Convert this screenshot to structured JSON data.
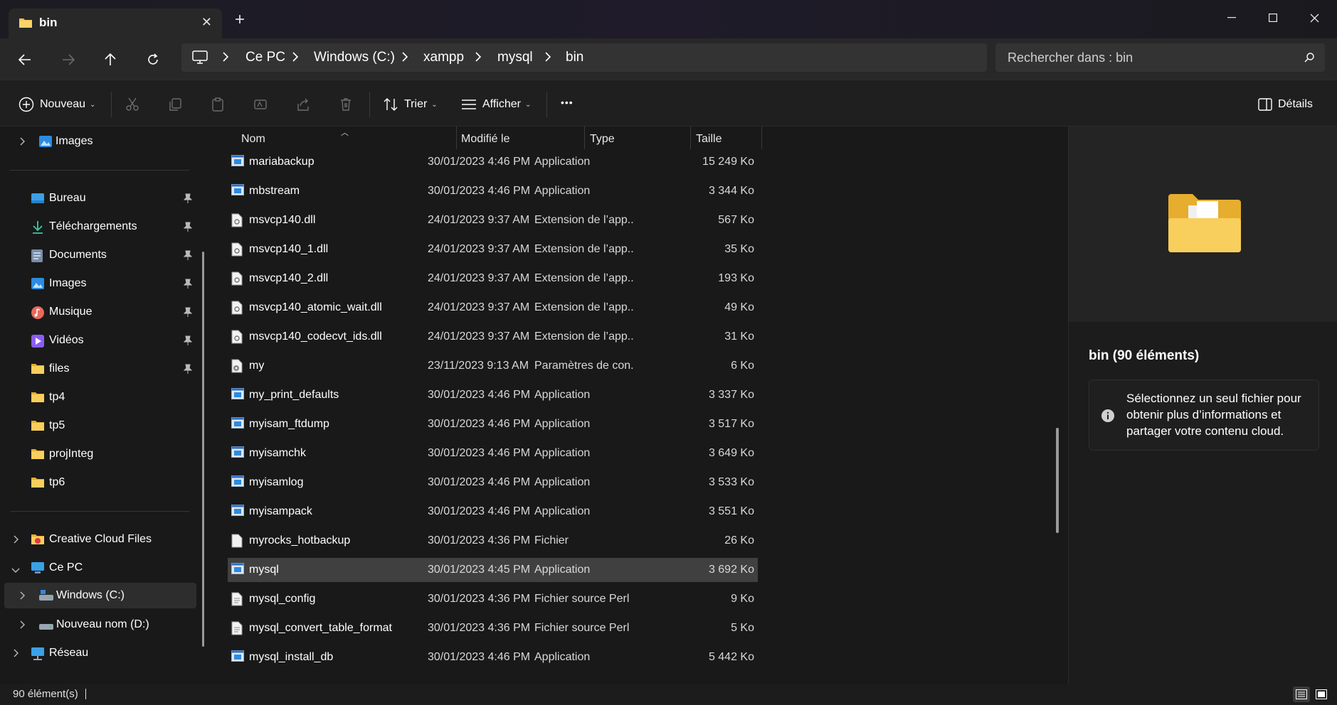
{
  "window": {
    "tab_title": "bin",
    "close_tab": "✕",
    "new_tab": "+"
  },
  "breadcrumb": [
    "Ce PC",
    "Windows (C:)",
    "xampp",
    "mysql",
    "bin"
  ],
  "search": {
    "placeholder": "Rechercher dans : bin"
  },
  "toolbar": {
    "new_label": "Nouveau",
    "sort_label": "Trier",
    "view_label": "Afficher",
    "more_label": "•••",
    "details_label": "Détails"
  },
  "sidebar": {
    "top": {
      "label": "Images"
    },
    "quick_access": [
      {
        "label": "Bureau",
        "icon": "desktop-icon"
      },
      {
        "label": "Téléchargements",
        "icon": "download-icon"
      },
      {
        "label": "Documents",
        "icon": "documents-icon"
      },
      {
        "label": "Images",
        "icon": "pictures-icon"
      },
      {
        "label": "Musique",
        "icon": "music-icon"
      },
      {
        "label": "Vidéos",
        "icon": "videos-icon"
      },
      {
        "label": "files",
        "icon": "folder-icon"
      },
      {
        "label": "tp4",
        "icon": "folder-icon"
      },
      {
        "label": "tp5",
        "icon": "folder-icon"
      },
      {
        "label": "projInteg",
        "icon": "folder-icon"
      },
      {
        "label": "tp6",
        "icon": "folder-icon"
      }
    ],
    "tree": [
      {
        "label": "Creative Cloud Files"
      },
      {
        "label": "Ce PC"
      },
      {
        "label": "Windows (C:)"
      },
      {
        "label": "Nouveau nom (D:)"
      },
      {
        "label": "Réseau"
      }
    ]
  },
  "columns": {
    "name": "Nom",
    "modified": "Modifié le",
    "type": "Type",
    "size": "Taille"
  },
  "files": [
    {
      "name": "mariabackup",
      "date": "30/01/2023 4:46 PM",
      "type": "Application",
      "size": "15 249 Ko",
      "icon": "app"
    },
    {
      "name": "mbstream",
      "date": "30/01/2023 4:46 PM",
      "type": "Application",
      "size": "3 344 Ko",
      "icon": "app"
    },
    {
      "name": "msvcp140.dll",
      "date": "24/01/2023 9:37 AM",
      "type": "Extension de l’app...",
      "size": "567 Ko",
      "icon": "dll"
    },
    {
      "name": "msvcp140_1.dll",
      "date": "24/01/2023 9:37 AM",
      "type": "Extension de l’app...",
      "size": "35 Ko",
      "icon": "dll"
    },
    {
      "name": "msvcp140_2.dll",
      "date": "24/01/2023 9:37 AM",
      "type": "Extension de l’app...",
      "size": "193 Ko",
      "icon": "dll"
    },
    {
      "name": "msvcp140_atomic_wait.dll",
      "date": "24/01/2023 9:37 AM",
      "type": "Extension de l’app...",
      "size": "49 Ko",
      "icon": "dll"
    },
    {
      "name": "msvcp140_codecvt_ids.dll",
      "date": "24/01/2023 9:37 AM",
      "type": "Extension de l’app...",
      "size": "31 Ko",
      "icon": "dll"
    },
    {
      "name": "my",
      "date": "23/11/2023 9:13 AM",
      "type": "Paramètres de con...",
      "size": "6 Ko",
      "icon": "config"
    },
    {
      "name": "my_print_defaults",
      "date": "30/01/2023 4:46 PM",
      "type": "Application",
      "size": "3 337 Ko",
      "icon": "app"
    },
    {
      "name": "myisam_ftdump",
      "date": "30/01/2023 4:46 PM",
      "type": "Application",
      "size": "3 517 Ko",
      "icon": "app"
    },
    {
      "name": "myisamchk",
      "date": "30/01/2023 4:46 PM",
      "type": "Application",
      "size": "3 649 Ko",
      "icon": "app"
    },
    {
      "name": "myisamlog",
      "date": "30/01/2023 4:46 PM",
      "type": "Application",
      "size": "3 533 Ko",
      "icon": "app"
    },
    {
      "name": "myisampack",
      "date": "30/01/2023 4:46 PM",
      "type": "Application",
      "size": "3 551 Ko",
      "icon": "app"
    },
    {
      "name": "myrocks_hotbackup",
      "date": "30/01/2023 4:36 PM",
      "type": "Fichier",
      "size": "26 Ko",
      "icon": "file"
    },
    {
      "name": "mysql",
      "date": "30/01/2023 4:45 PM",
      "type": "Application",
      "size": "3 692 Ko",
      "icon": "app",
      "selected": true
    },
    {
      "name": "mysql_config",
      "date": "30/01/2023 4:36 PM",
      "type": "Fichier source Perl",
      "size": "9 Ko",
      "icon": "text"
    },
    {
      "name": "mysql_convert_table_format",
      "date": "30/01/2023 4:36 PM",
      "type": "Fichier source Perl",
      "size": "5 Ko",
      "icon": "text"
    },
    {
      "name": "mysql_install_db",
      "date": "30/01/2023 4:46 PM",
      "type": "Application",
      "size": "5 442 Ko",
      "icon": "app"
    }
  ],
  "details": {
    "title": "bin (90 éléments)",
    "info": "Sélectionnez un seul fichier pour obtenir plus d’informations et partager votre contenu cloud."
  },
  "status": {
    "count": "90 élément(s)"
  },
  "colors": {
    "accent": "#4cc2ff",
    "folder": "#f3c54e",
    "selected_row": "#404040"
  }
}
